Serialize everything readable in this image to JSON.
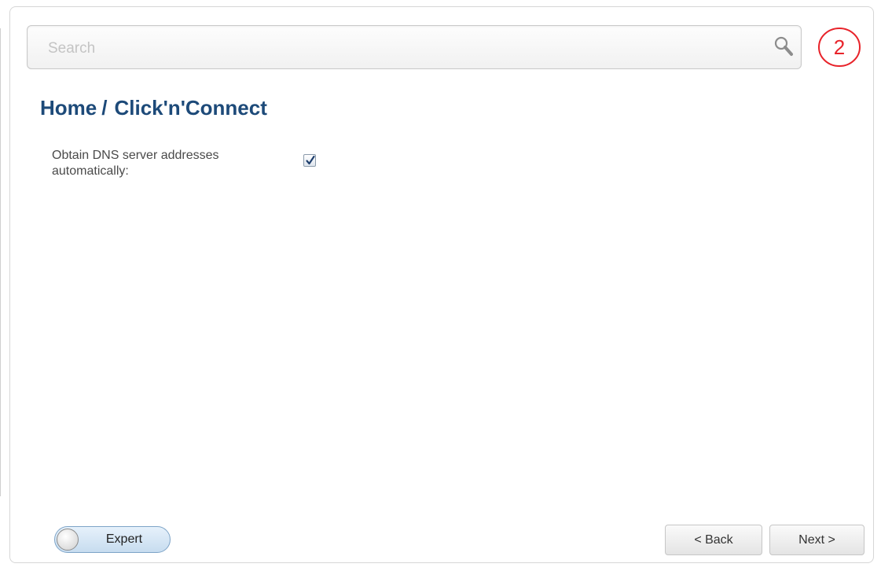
{
  "search": {
    "placeholder": "Search",
    "value": ""
  },
  "step_badge": {
    "number": "2",
    "color": "#e8232a"
  },
  "breadcrumb": {
    "home": "Home",
    "separator": "/",
    "current": "Click'n'Connect"
  },
  "form": {
    "dns_auto": {
      "label": "Obtain DNS server addresses automatically:",
      "checked": true
    }
  },
  "footer": {
    "expert_label": "Expert",
    "expert_enabled": false,
    "back_label": "< Back",
    "next_label": "Next >"
  },
  "colors": {
    "title": "#1d4a79",
    "toggle_fill": "#c7dcef",
    "badge": "#e8232a"
  },
  "icons": {
    "search": "search-icon",
    "checkmark": "checkmark-icon"
  }
}
